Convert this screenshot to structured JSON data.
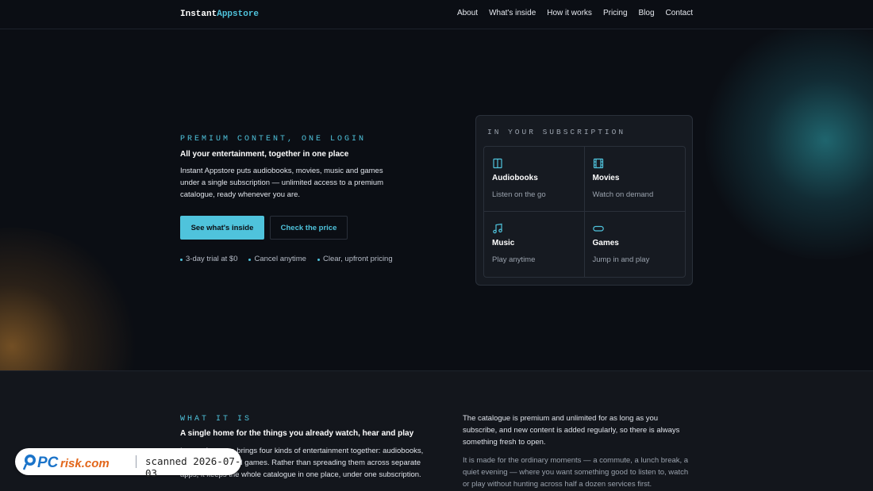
{
  "nav": {
    "brand_prefix": "Instant",
    "brand_suffix": "Appstore",
    "links": [
      "About",
      "What's inside",
      "How it works",
      "Pricing",
      "Blog",
      "Contact"
    ]
  },
  "hero": {
    "eyebrow": "PREMIUM CONTENT, ONE LOGIN",
    "title": "All your entertainment, together in one place",
    "description": "Instant Appstore puts audiobooks, movies, music and games under a single subscription — unlimited access to a premium catalogue, ready whenever you are.",
    "primary_button": "See what's inside",
    "secondary_button": "Check the price",
    "perks": [
      "3-day trial at $0",
      "Cancel anytime",
      "Clear, upfront pricing"
    ]
  },
  "subscription": {
    "heading": "IN YOUR SUBSCRIPTION",
    "items": [
      {
        "icon": "book-icon",
        "name": "Audiobooks",
        "desc": "Listen on the go"
      },
      {
        "icon": "film-icon",
        "name": "Movies",
        "desc": "Watch on demand"
      },
      {
        "icon": "music-note-icon",
        "name": "Music",
        "desc": "Play anytime"
      },
      {
        "icon": "gamepad-icon",
        "name": "Games",
        "desc": "Jump in and play"
      }
    ]
  },
  "what_it_is": {
    "eyebrow": "WHAT IT IS",
    "title": "A single home for the things you already watch, hear and play",
    "description": "Instant Appstore brings four kinds of entertainment together: audiobooks, movies, music and games. Rather than spreading them across separate apps, it keeps the whole catalogue in one place, under one subscription.",
    "right_paragraph_1": "The catalogue is premium and unlimited for as long as you subscribe, and new content is added regularly, so there is always something fresh to open.",
    "right_paragraph_2": "It is made for the ordinary moments — a commute, a lunch break, a quiet evening — where you want something good to listen to, watch or play without hunting across half a dozen services first."
  },
  "watermark": {
    "logo_text": "PCrisk.com",
    "scan_text": "scanned 2026-07-03"
  },
  "colors": {
    "accent": "#4fc3dc",
    "background": "#0b0e14",
    "card": "#161a21"
  }
}
